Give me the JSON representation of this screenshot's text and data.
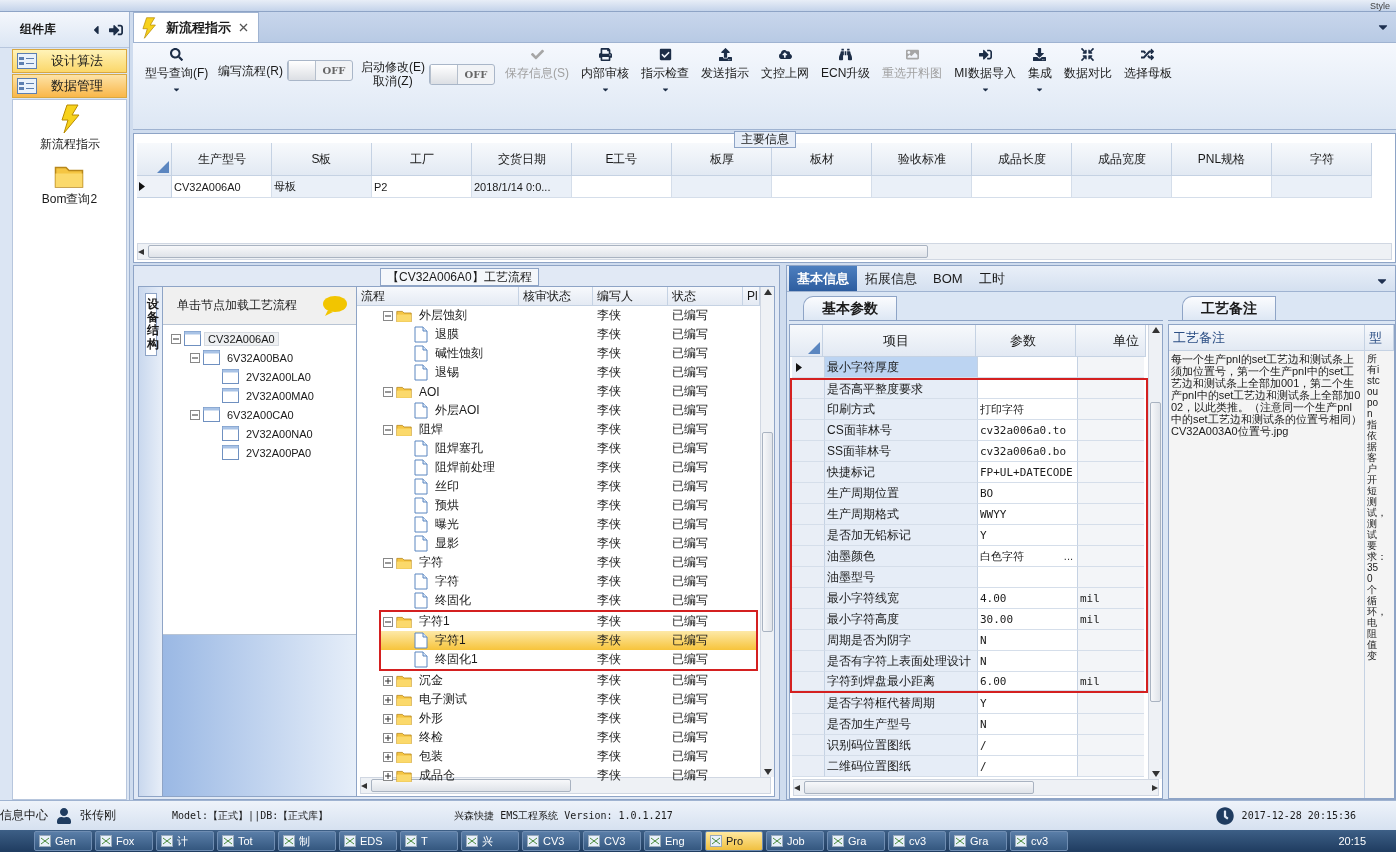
{
  "top_bar": {
    "style_label": "Style"
  },
  "sidebar": {
    "title": "组件库",
    "groups": [
      {
        "label": "设计算法",
        "selected": false
      },
      {
        "label": "数据管理",
        "selected": true
      }
    ],
    "items": [
      {
        "label": "新流程指示",
        "kind": "bolt"
      },
      {
        "label": "Bom查询2",
        "kind": "folder"
      }
    ]
  },
  "doc_tabs": [
    {
      "label": "新流程指示",
      "selected": true
    }
  ],
  "toolbar": [
    {
      "kind": "button",
      "label": "型号查询(F)",
      "disabled": false,
      "dropdown": true
    },
    {
      "kind": "toggle",
      "label": "编写流程(R)",
      "on": false,
      "state_label": "OFF"
    },
    {
      "kind": "toggle",
      "label": "启动修改(E)\n取消(Z)",
      "on": false,
      "state_label": "OFF"
    },
    {
      "kind": "button",
      "label": "保存信息(S)",
      "disabled": true,
      "dropdown": false
    },
    {
      "kind": "button",
      "label": "内部审核",
      "disabled": false,
      "dropdown": true
    },
    {
      "kind": "button",
      "label": "指示检查",
      "disabled": false,
      "dropdown": true
    },
    {
      "kind": "button",
      "label": "发送指示",
      "disabled": false,
      "dropdown": false
    },
    {
      "kind": "button",
      "label": "文控上网",
      "disabled": false,
      "dropdown": false
    },
    {
      "kind": "button",
      "label": "ECN升级",
      "disabled": false,
      "dropdown": false
    },
    {
      "kind": "button",
      "label": "重选开料图",
      "disabled": true,
      "dropdown": false
    },
    {
      "kind": "button",
      "label": "MI数据导入",
      "disabled": false,
      "dropdown": true
    },
    {
      "kind": "button",
      "label": "集成",
      "disabled": false,
      "dropdown": true
    },
    {
      "kind": "button",
      "label": "数据对比",
      "disabled": false,
      "dropdown": false
    },
    {
      "kind": "button",
      "label": "选择母板",
      "disabled": false,
      "dropdown": false
    }
  ],
  "main_info": {
    "title": "主要信息",
    "columns": [
      "生产型号",
      "S板",
      "工厂",
      "交货日期",
      "E工号",
      "板厚",
      "板材",
      "验收标准",
      "成品长度",
      "成品宽度",
      "PNL规格",
      "字符"
    ],
    "rows": [
      {
        "selected": true,
        "cells": [
          "CV32A006A0",
          "母板",
          "P2",
          "2018/1/14 0:0..."
        ]
      }
    ]
  },
  "process": {
    "title": "【CV32A006A0】工艺流程",
    "structure": {
      "tab": "设备结构",
      "hint": "单击节点加载工艺流程",
      "tree": [
        {
          "label": "CV32A006A0",
          "expanded": true,
          "selected": true,
          "children": [
            {
              "label": "6V32A00BA0",
              "expanded": true,
              "selected": false,
              "children": [
                {
                  "label": "2V32A00LA0",
                  "selected": false
                },
                {
                  "label": "2V32A00MA0",
                  "selected": false
                }
              ]
            },
            {
              "label": "6V32A00CA0",
              "expanded": true,
              "selected": false,
              "children": [
                {
                  "label": "2V32A00NA0",
                  "selected": false
                },
                {
                  "label": "2V32A00PA0",
                  "selected": false
                }
              ]
            }
          ]
        }
      ]
    },
    "flow": {
      "columns": [
        "流程",
        "核审状态",
        "编写人",
        "状态",
        "Pl"
      ],
      "rows": [
        {
          "name": "外层蚀刻",
          "kind": "folder",
          "expanded": true,
          "framed": false,
          "selected": false,
          "writer": "李侠",
          "status": "已编写",
          "children": [
            {
              "name": "退膜",
              "kind": "file",
              "selected": false,
              "writer": "李侠",
              "status": "已编写"
            },
            {
              "name": "碱性蚀刻",
              "kind": "file",
              "selected": false,
              "writer": "李侠",
              "status": "已编写"
            },
            {
              "name": "退锡",
              "kind": "file",
              "selected": false,
              "writer": "李侠",
              "status": "已编写"
            }
          ]
        },
        {
          "name": "AOI",
          "kind": "folder",
          "expanded": true,
          "framed": false,
          "selected": false,
          "writer": "李侠",
          "status": "已编写",
          "children": [
            {
              "name": "外层AOI",
              "kind": "file",
              "selected": false,
              "writer": "李侠",
              "status": "已编写"
            }
          ]
        },
        {
          "name": "阻焊",
          "kind": "folder",
          "expanded": true,
          "framed": false,
          "selected": false,
          "writer": "李侠",
          "status": "已编写",
          "children": [
            {
              "name": "阻焊塞孔",
              "kind": "file",
              "selected": false,
              "writer": "李侠",
              "status": "已编写"
            },
            {
              "name": "阻焊前处理",
              "kind": "file",
              "selected": false,
              "writer": "李侠",
              "status": "已编写"
            },
            {
              "name": "丝印",
              "kind": "file",
              "selected": false,
              "writer": "李侠",
              "status": "已编写"
            },
            {
              "name": "预烘",
              "kind": "file",
              "selected": false,
              "writer": "李侠",
              "status": "已编写"
            },
            {
              "name": "曝光",
              "kind": "file",
              "selected": false,
              "writer": "李侠",
              "status": "已编写"
            },
            {
              "name": "显影",
              "kind": "file",
              "selected": false,
              "writer": "李侠",
              "status": "已编写"
            }
          ]
        },
        {
          "name": "字符",
          "kind": "folder",
          "expanded": true,
          "framed": false,
          "selected": false,
          "writer": "李侠",
          "status": "已编写",
          "children": [
            {
              "name": "字符",
              "kind": "file",
              "selected": false,
              "writer": "李侠",
              "status": "已编写"
            },
            {
              "name": "终固化",
              "kind": "file",
              "selected": false,
              "writer": "李侠",
              "status": "已编写"
            }
          ]
        },
        {
          "name": "字符1",
          "kind": "folder",
          "expanded": true,
          "framed": true,
          "selected": false,
          "writer": "李侠",
          "status": "已编写",
          "children": [
            {
              "name": "字符1",
              "kind": "file",
              "selected": true,
              "writer": "李侠",
              "status": "已编写"
            },
            {
              "name": "终固化1",
              "kind": "file",
              "selected": false,
              "writer": "李侠",
              "status": "已编写"
            }
          ]
        },
        {
          "name": "沉金",
          "kind": "folder",
          "expanded": false,
          "framed": false,
          "selected": false,
          "writer": "李侠",
          "status": "已编写"
        },
        {
          "name": "电子测试",
          "kind": "folder",
          "expanded": false,
          "framed": false,
          "selected": false,
          "writer": "李侠",
          "status": "已编写"
        },
        {
          "name": "外形",
          "kind": "folder",
          "expanded": false,
          "framed": false,
          "selected": false,
          "writer": "李侠",
          "status": "已编写"
        },
        {
          "name": "终检",
          "kind": "folder",
          "expanded": false,
          "framed": false,
          "selected": false,
          "writer": "李侠",
          "status": "已编写"
        },
        {
          "name": "包装",
          "kind": "folder",
          "expanded": false,
          "framed": false,
          "selected": false,
          "writer": "李侠",
          "status": "已编写"
        },
        {
          "name": "成品仓",
          "kind": "folder",
          "expanded": false,
          "framed": false,
          "selected": false,
          "writer": "李侠",
          "status": "已编写"
        }
      ]
    }
  },
  "details": {
    "tabs": [
      {
        "label": "基本信息",
        "selected": true
      },
      {
        "label": "拓展信息",
        "selected": false
      },
      {
        "label": "BOM",
        "selected": false
      },
      {
        "label": "工时",
        "selected": false
      }
    ],
    "params": {
      "tab": "基本参数",
      "columns": [
        "项目",
        "参数",
        "单位"
      ],
      "rows": [
        {
          "item": "最小字符厚度",
          "selected": true,
          "framed": false,
          "kind": "text"
        },
        {
          "item": "是否高平整度要求",
          "selected": false,
          "framed": true,
          "kind": "text"
        },
        {
          "item": "印刷方式",
          "value": "打印字符",
          "selected": false,
          "framed": true,
          "kind": "text"
        },
        {
          "item": "CS面菲林号",
          "value": "cv32a006a0.to",
          "selected": false,
          "framed": true,
          "kind": "text"
        },
        {
          "item": "SS面菲林号",
          "value": "cv32a006a0.bo",
          "selected": false,
          "framed": true,
          "kind": "text"
        },
        {
          "item": "快捷标记",
          "value": "FP+UL+DATECODE",
          "selected": false,
          "framed": true,
          "kind": "text"
        },
        {
          "item": "生产周期位置",
          "value": "BO",
          "selected": false,
          "framed": true,
          "kind": "text"
        },
        {
          "item": "生产周期格式",
          "value": "WWYY",
          "selected": false,
          "framed": true,
          "kind": "text"
        },
        {
          "item": "是否加无铅标记",
          "value": "Y",
          "selected": false,
          "framed": true,
          "kind": "text"
        },
        {
          "item": "油墨颜色",
          "value": "白色字符",
          "button_text": "...",
          "selected": false,
          "framed": true,
          "kind": "picker"
        },
        {
          "item": "油墨型号",
          "selected": false,
          "framed": true,
          "kind": "text"
        },
        {
          "item": "最小字符线宽",
          "value": "4.00",
          "unit": "mil",
          "selected": false,
          "framed": true,
          "kind": "text"
        },
        {
          "item": "最小字符高度",
          "value": "30.00",
          "unit": "mil",
          "selected": false,
          "framed": true,
          "kind": "text"
        },
        {
          "item": "周期是否为阴字",
          "value": "N",
          "selected": false,
          "framed": true,
          "kind": "text"
        },
        {
          "item": "是否有字符上表面处理设计",
          "value": "N",
          "selected": false,
          "framed": true,
          "kind": "text"
        },
        {
          "item": "字符到焊盘最小距离",
          "value": "6.00",
          "unit": "mil",
          "selected": false,
          "framed": true,
          "kind": "text"
        },
        {
          "item": "是否字符框代替周期",
          "value": "Y",
          "selected": false,
          "framed": false,
          "kind": "text"
        },
        {
          "item": "是否加生产型号",
          "value": "N",
          "selected": false,
          "framed": false,
          "kind": "text"
        },
        {
          "item": "识别码位置图纸",
          "value": "/",
          "selected": false,
          "framed": false,
          "kind": "text"
        },
        {
          "item": "二维码位置图纸",
          "value": "/",
          "selected": false,
          "framed": false,
          "kind": "text"
        }
      ]
    },
    "notes": {
      "tab": "工艺备注",
      "columns": [
        "工艺备注",
        "型"
      ],
      "text": "每一个生产pnl的set工艺边和测试条上须加位置号，第一个生产pnl中的set工艺边和测试条上全部加001，第二个生产pnl中的set工艺边和测试条上全部加002，以此类推。（注意同一个生产pnl中的set工艺边和测试条的位置号相同）CV32A003A0位置号.jpg",
      "side_text": "所有istcoupon指依据客户开短测试，测试要求：350个循环，电阻值变"
    }
  },
  "status_bar": {
    "section": "信息中心",
    "user": "张传刚",
    "model": "Model:【正式】||DB:【正式库】",
    "system": "兴森快捷 EMS工程系统 Version: 1.0.1.217",
    "datetime": "2017-12-28 20:15:36"
  },
  "taskbar": {
    "items": [
      {
        "label": "Gen",
        "selected": false
      },
      {
        "label": "Fox",
        "selected": false
      },
      {
        "label": "计",
        "selected": false
      },
      {
        "label": "Tot",
        "selected": false
      },
      {
        "label": "制",
        "selected": false
      },
      {
        "label": "EDS",
        "selected": false
      },
      {
        "label": "T",
        "selected": false
      },
      {
        "label": "兴",
        "selected": false
      },
      {
        "label": "CV3",
        "selected": false
      },
      {
        "label": "CV3",
        "selected": false
      },
      {
        "label": "Eng",
        "selected": false
      },
      {
        "label": "Pro",
        "selected": true
      },
      {
        "label": "Job",
        "selected": false
      },
      {
        "label": "Gra",
        "selected": false
      },
      {
        "label": "cv3",
        "selected": false
      },
      {
        "label": "Gra",
        "selected": false
      },
      {
        "label": "cv3",
        "selected": false
      }
    ],
    "clock": "20:15"
  }
}
